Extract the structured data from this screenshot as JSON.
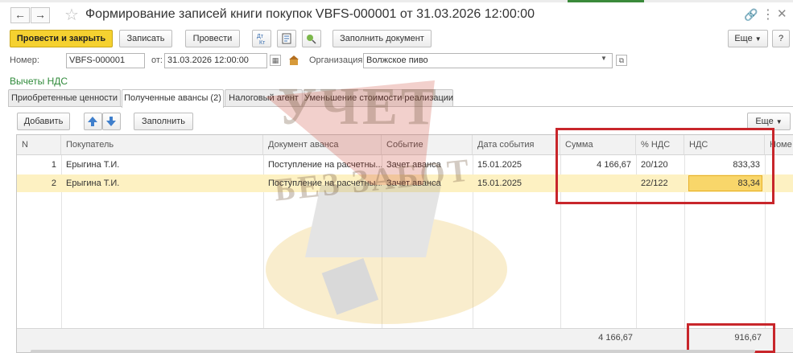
{
  "window": {
    "title": "Формирование записей книги покупок VBFS-000001 от 31.03.2026 12:00:00",
    "back_icon": "arrow-left-icon",
    "forward_icon": "arrow-right-icon",
    "favorite_icon": "star-icon"
  },
  "toolbar": {
    "post_close_label": "Провести и закрыть",
    "save_label": "Записать",
    "post_label": "Провести",
    "fill_document_label": "Заполнить документ",
    "more_label": "Еще",
    "help_label": "?"
  },
  "header": {
    "number_label": "Номер:",
    "number_value": "VBFS-000001",
    "date_label": "от:",
    "date_value": "31.03.2026 12:00:00",
    "org_label": "Организация:",
    "org_value": "Волжское пиво"
  },
  "section_title": "Вычеты НДС",
  "tabs": [
    {
      "label": "Приобретенные ценности"
    },
    {
      "label": "Полученные авансы (2)"
    },
    {
      "label": "Налоговый агент"
    },
    {
      "label": "Уменьшение стоимости реализации"
    }
  ],
  "table_toolbar": {
    "add_label": "Добавить",
    "fill_label": "Заполнить",
    "more_label": "Еще"
  },
  "table": {
    "columns": [
      "N",
      "Покупатель",
      "Документ аванса",
      "Событие",
      "Дата события",
      "Сумма",
      "% НДС",
      "НДС",
      "Номе"
    ],
    "rows": [
      {
        "n": "1",
        "buyer": "Ерыгина Т.И.",
        "doc": "Поступление на расчетны...",
        "event": "Зачет аванса",
        "date": "15.01.2025",
        "sum": "4 166,67",
        "rate": "20/120",
        "vat": "833,33"
      },
      {
        "n": "2",
        "buyer": "Ерыгина Т.И.",
        "doc": "Поступление на расчетны...",
        "event": "Зачет аванса",
        "date": "15.01.2025",
        "sum": "",
        "rate": "22/122",
        "vat": "83,34"
      }
    ],
    "totals": {
      "sum": "4 166,67",
      "vat": "916,67"
    }
  },
  "watermark": {
    "line1": "УЧЕТ",
    "line2": "БЕЗ ЗАБОТ"
  },
  "colors": {
    "primary_button": "#f5d130",
    "section_title": "#2f8a3a",
    "selected_row": "#fdf1c2",
    "highlight_box": "#c8262b"
  }
}
